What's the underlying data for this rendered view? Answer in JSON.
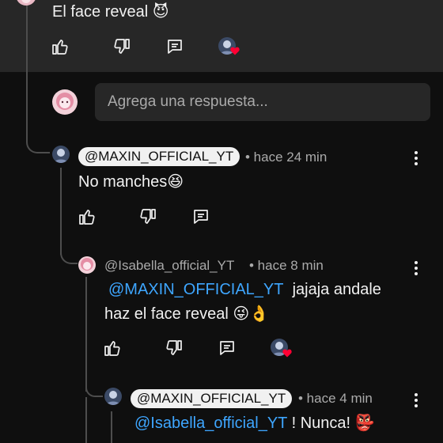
{
  "comment_top": {
    "text": "El face reveal",
    "emoji": "😈"
  },
  "reply_box": {
    "placeholder": "Agrega una respuesta..."
  },
  "replies": [
    {
      "author": "@MAXIN_OFFICIAL_YT",
      "time": "• hace 24 min",
      "text": "No manches",
      "emoji": "😆"
    },
    {
      "author": "@Isabella_official_YT",
      "time": "• hace 8 min",
      "mention": "@MAXIN_OFFICIAL_YT",
      "text_after_mention": "jajaja andale",
      "text_line2": "haz el face reveal",
      "emoji": "😜👌"
    },
    {
      "author": "@MAXIN_OFFICIAL_YT",
      "time": "• hace 4 min",
      "mention": "@Isabella_official_YT",
      "text_after_mention": "! Nunca!",
      "emoji": "👺"
    }
  ],
  "icons": {
    "like": "like-icon",
    "dislike": "dislike-icon",
    "reply": "reply-icon",
    "more": "more-vert-icon",
    "creator_heart": "heart-icon"
  },
  "colors": {
    "background": "#0f0f0f",
    "highlight": "#272727",
    "link": "#3ea6ff",
    "heart": "#ff0033"
  }
}
